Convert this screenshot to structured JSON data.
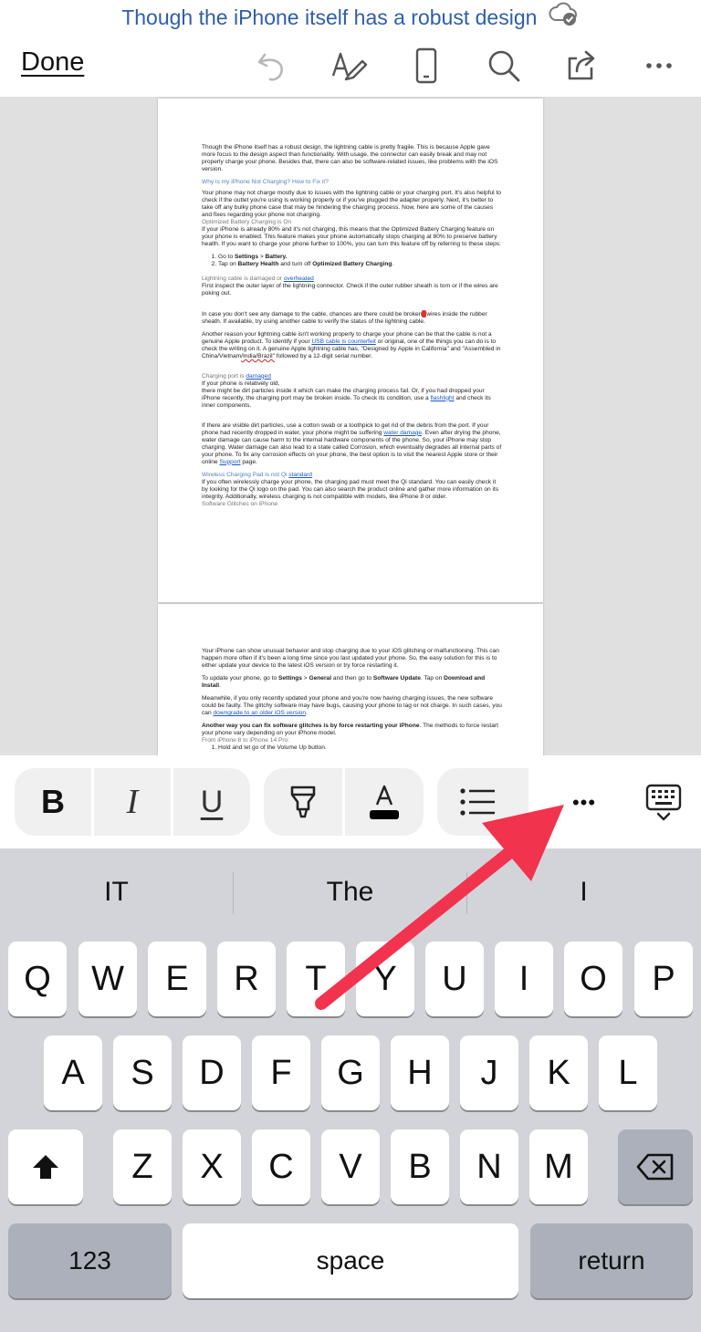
{
  "header": {
    "doc_title": "Though the iPhone itself has a robust design",
    "done_label": "Done"
  },
  "toolbar_icons": [
    "undo-icon",
    "draw-icon",
    "mobile-view-icon",
    "search-icon",
    "share-icon",
    "more-icon"
  ],
  "document": {
    "page1": {
      "p1": "Though the iPhone itself has a robust design, the lightning cable is pretty fragile. This is because Apple gave more focus to the design aspect than functionality. With usage, the connector can easily break and may not properly charge your phone. Besides that, there can also be software-related issues, like problems with the iOS version.",
      "h1": "Why is my iPhone Not Charging? How to Fix it?",
      "p2": "Your phone may not charge mostly due to issues with the lightning cable or your charging port. It's also helpful to check if the outlet you're using is working properly or if you've plugged the adapter properly. Next, it's better to take off any bulky phone case that may be hindering the charging process. Now, here are some of the causes and fixes regarding your phone not charging.",
      "h2": "Optimized Battery Charging is On",
      "p3": "If your iPhone is already 80% and it's not charging, this means that the Optimized Battery Charging feature on your phone is enabled. This feature makes your phone automatically stops charging at 80% to preserve battery health. If you want to charge your phone further to 100%, you can turn this feature off by referring to these steps:",
      "li1_pre": "Go to ",
      "li1_b1": "Settings",
      "li1_mid": " > ",
      "li1_b2": "Battery.",
      "li2_pre": "Tap on ",
      "li2_b1": "Battery Health",
      "li2_mid": " and turn off ",
      "li2_b2": "Optimized Battery Charging",
      "li2_end": ".",
      "h3_pre": "Lightning cable is damaged or ",
      "h3_link": "overheated",
      "p4": "First inspect the outer layer of the lightning connector. Check if the outer rubber sheath is torn or if the wires are poking out.",
      "p5a": "In case you don't see any damage to the cable, chances are there could be broken",
      "p5b": "wires inside the rubber sheath. If available, try using another cable to verify the status of the lightning cable.",
      "p6a": "Another reason your lightning cable isn't working properly to charge your phone can be that the cable is not a genuine Apple product. To identify if your ",
      "p6link": "USB cable is counterfeit",
      "p6b": " or original, one of the things you can do is to check the writing on it. A genuine Apple lightning cable has, \"Designed by Apple in California\" and \"Assembled in China/Vietnam",
      "p6sq": "/India/Brazil\"",
      "p6c": " followed by a 12-digit serial number.",
      "h4_pre": "Charging port is ",
      "h4_link": "damaged",
      "p7a": "If your phone is relatively old,",
      "p7b": "there might be dirt particles inside it which can make the charging process fail. Or, if you had dropped your iPhone recently, the charging port may be broken inside. To check its condition, use a ",
      "p7link": "flashlight",
      "p7c": " and check its inner components.",
      "p8a": "If there are visible dirt particles, use a cotton swab or a toothpick to get rid of the debris from the port. If your phone had recently dropped in water, your phone might be suffering ",
      "p8link": "water damage",
      "p8b": ". Even after drying the phone, water damage can cause harm to the internal hardware components of the phone. So, your iPhone may stop charging. Water damage can also lead to a state called Corrosion, which eventually degrades all internal parts of your phone. To fix any corrosion effects on your phone, the best option is to visit the nearest Apple store or their online ",
      "p8link2": "Support",
      "p8c": " page.",
      "h5_pre": "Wireless Charging Pad is not Qi ",
      "h5_link": "standard",
      "p9": "If you often wirelessly charge your phone, the charging pad must meet the Qi standard. You can easily check it by looking for the Qi logo on the pad. You can also search the product online and gather more information on its integrity. Additionally, wireless charging is not compatible with models, like iPhone 8 or older.",
      "h6": "Software Glitches on iPhone"
    },
    "page2": {
      "p1": "Your iPhone can show unusual behavior and stop charging due to your iOS glitching or malfunctioning. This can happen more often if it's been a long time since you last updated your phone. So, the easy solution for this is to either update your device to the latest iOS version or try force restarting it.",
      "p2_pre": "To update your phone, go to ",
      "p2_b1": "Settings",
      "p2_mid": " > ",
      "p2_b2": "General",
      "p2_mid2": " and then go to ",
      "p2_b3": "Software Update",
      "p2_mid3": ". Tap on ",
      "p2_b4": "Download and Install",
      "p2_end": ".",
      "p3a": "Meanwhile, if you only recently updated your phone and you're now having charging issues, the new software could be faulty. The glitchy software may have bugs, causing your phone to lag or not charge. In such cases, you can ",
      "p3link": "downgrade to an older iOS version",
      "p3b": ".",
      "p4b": "Another way you can fix software glitches is by force restarting your iPhone",
      "p4": ". The methods to force restart your phone vary depending on your iPhone model.",
      "h1": "From iPhone 8 to iPhone 14 Pro:",
      "li1": "Hold and let go of the Volume Up button."
    }
  },
  "format_bar": {
    "bold": "B",
    "italic": "I",
    "underline": "U",
    "more": "•••"
  },
  "keyboard": {
    "suggestions": [
      "IT",
      "The",
      "I"
    ],
    "row1": [
      "Q",
      "W",
      "E",
      "R",
      "T",
      "Y",
      "U",
      "I",
      "O",
      "P"
    ],
    "row2": [
      "A",
      "S",
      "D",
      "F",
      "G",
      "H",
      "J",
      "K",
      "L"
    ],
    "row3": [
      "Z",
      "X",
      "C",
      "V",
      "B",
      "N",
      "M"
    ],
    "numbers_label": "123",
    "space_label": "space",
    "return_label": "return"
  },
  "colors": {
    "title_blue": "#2f5eaa",
    "arrow_red": "#f2334e",
    "keyboard_bg": "#d3d4d9"
  }
}
